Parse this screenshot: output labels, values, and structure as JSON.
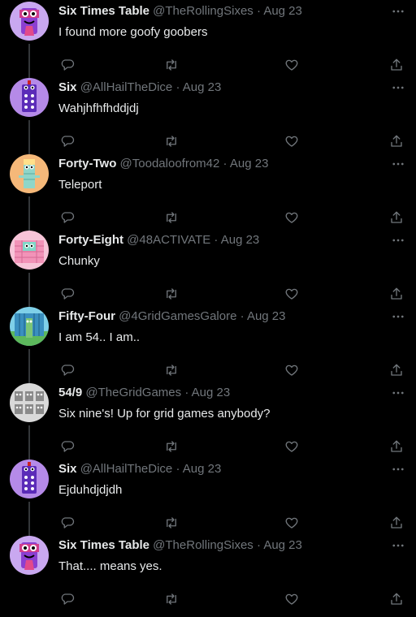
{
  "tweets": [
    {
      "name": "Six Times Table",
      "handle": "@TheRollingSixes",
      "sep": "·",
      "date": "Aug 23",
      "text": "I found more goofy goobers",
      "avatar": "six-times-table-avatar"
    },
    {
      "name": "Six",
      "handle": "@AllHailTheDice",
      "sep": "·",
      "date": "Aug 23",
      "text": "Wahjhfhfhddjdj",
      "avatar": "six-avatar"
    },
    {
      "name": "Forty-Two",
      "handle": "@Toodaloofrom42",
      "sep": "·",
      "date": "Aug 23",
      "text": "Teleport",
      "avatar": "forty-two-avatar"
    },
    {
      "name": "Forty-Eight",
      "handle": "@48ACTIVATE",
      "sep": "·",
      "date": "Aug 23",
      "text": "Chunky",
      "avatar": "forty-eight-avatar"
    },
    {
      "name": "Fifty-Four",
      "handle": "@4GridGamesGalore",
      "sep": "·",
      "date": "Aug 23",
      "text": "I am 54.. I am..",
      "avatar": "fifty-four-avatar"
    },
    {
      "name": "54/9",
      "handle": "@TheGridGames",
      "sep": "·",
      "date": "Aug 23",
      "text": "Six nine's! Up for grid games anybody?",
      "avatar": "fifty-four-nine-avatar"
    },
    {
      "name": "Six",
      "handle": "@AllHailTheDice",
      "sep": "·",
      "date": "Aug 23",
      "text": "Ejduhdjdjdh",
      "avatar": "six-avatar"
    },
    {
      "name": "Six Times Table",
      "handle": "@TheRollingSixes",
      "sep": "·",
      "date": "Aug 23",
      "text": "That.... means yes.",
      "avatar": "six-times-table-avatar"
    }
  ],
  "icons": {
    "more": "more-horizontal-icon",
    "reply": "reply-icon",
    "retweet": "retweet-icon",
    "like": "heart-icon",
    "share": "share-icon"
  },
  "colors": {
    "background": "#000000",
    "text": "#e7e9ea",
    "muted": "#71767b",
    "connector": "#333639"
  }
}
